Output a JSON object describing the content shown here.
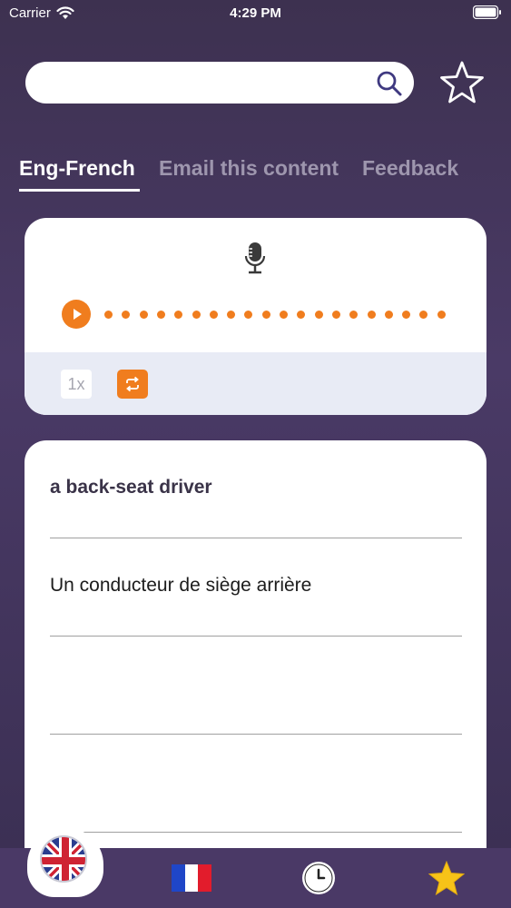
{
  "status_bar": {
    "carrier": "Carrier",
    "time": "4:29 PM"
  },
  "search": {
    "value": "",
    "placeholder": ""
  },
  "tabs": [
    {
      "label": "Eng-French",
      "active": true
    },
    {
      "label": "Email this content",
      "active": false
    },
    {
      "label": "Feedback",
      "active": false
    }
  ],
  "player": {
    "speed_label": "1x",
    "accent_color": "#f07d1e"
  },
  "content": {
    "lines": [
      "a back-seat driver",
      "Un conducteur de siège arrière",
      "",
      ""
    ]
  },
  "bottom_nav": {
    "items": [
      {
        "icon": "uk-flag-icon",
        "active": true
      },
      {
        "icon": "france-flag-icon",
        "active": false
      },
      {
        "icon": "clock-icon",
        "active": false
      },
      {
        "icon": "star-icon",
        "active": false
      }
    ]
  }
}
